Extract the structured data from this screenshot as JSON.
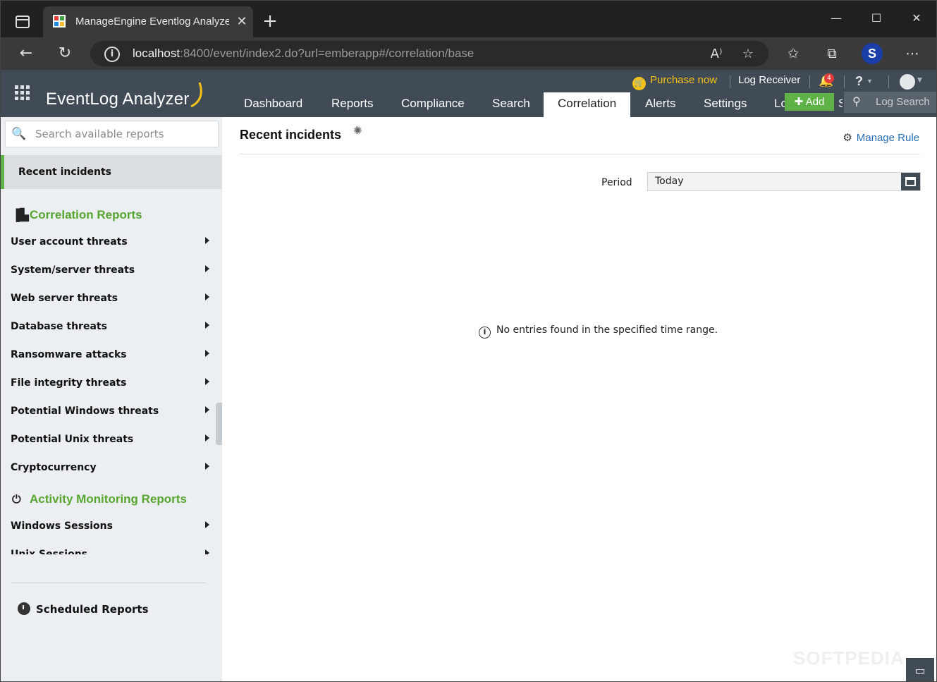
{
  "browser": {
    "tab_title": "ManageEngine Eventlog Analyzer",
    "tab_close": "✕",
    "new_tab": "+",
    "url_host": "localhost",
    "url_rest": ":8400/event/index2.do?url=emberapp#/correlation/base",
    "profile_initial": "S",
    "window_controls": {
      "minimize": "—",
      "maximize": "☐",
      "close": "✕"
    }
  },
  "app": {
    "brand": "EventLog Analyzer",
    "top_links": {
      "purchase": "Purchase now",
      "log_receiver": "Log Receiver",
      "notifications_count": "4",
      "help": "?"
    },
    "nav_tabs": [
      "Dashboard",
      "Reports",
      "Compliance",
      "Search",
      "Correlation",
      "Alerts",
      "Settings",
      "Lo",
      "S"
    ],
    "active_tab": "Correlation",
    "add_button": "Add",
    "log_search": "Log Search"
  },
  "sidebar": {
    "search_placeholder": "Search available reports",
    "recent_incidents": "Recent incidents",
    "correlation_heading": "Correlation Reports",
    "correlation_items": [
      "User account threats",
      "System/server threats",
      "Web server threats",
      "Database threats",
      "Ransomware attacks",
      "File integrity threats",
      "Potential Windows threats",
      "Potential Unix threats",
      "Cryptocurrency"
    ],
    "activity_heading": "Activity Monitoring Reports",
    "activity_items": [
      "Windows Sessions",
      "Unix Sessions"
    ],
    "scheduled": "Scheduled Reports"
  },
  "content": {
    "title": "Recent incidents",
    "manage_rule": "Manage Rule",
    "period_label": "Period",
    "period_value": "Today",
    "empty_message": "No entries found in the specified time range.",
    "watermark": "SOFTPEDIA"
  },
  "colors": {
    "header": "#404b55",
    "accent_green": "#5fb245",
    "link_blue": "#2a6fb7",
    "purchase_yellow": "#f2c21b"
  }
}
